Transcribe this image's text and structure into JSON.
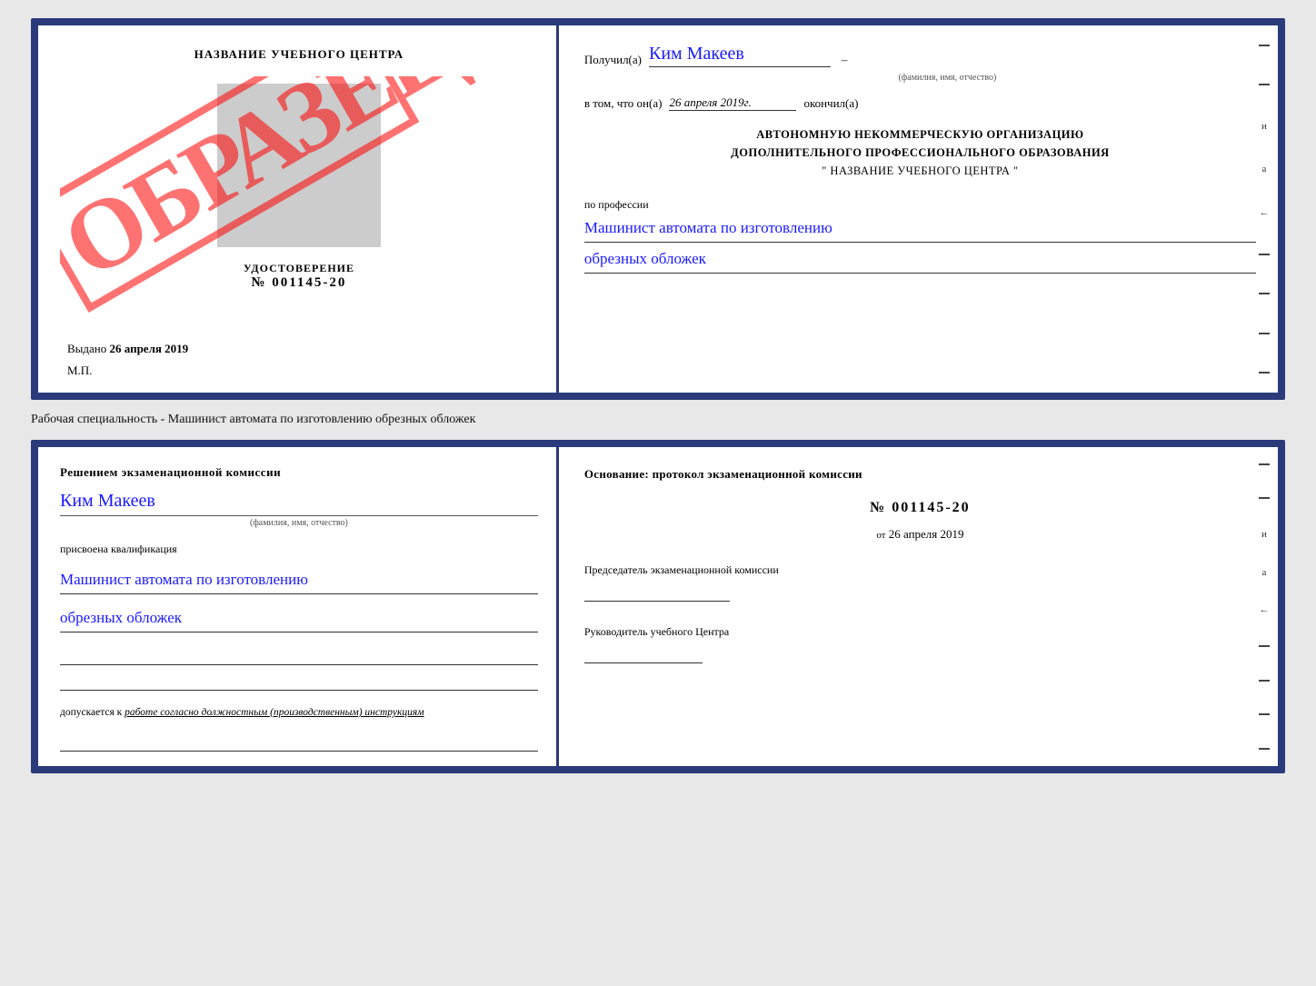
{
  "page": {
    "background": "#e8e8e8"
  },
  "certificate": {
    "left": {
      "title": "НАЗВАНИЕ УЧЕБНОГО ЦЕНТРА",
      "obrazets_text": "ОБРАЗЕЦ",
      "udostoverenie_label": "УДОСТОВЕРЕНИЕ",
      "number_prefix": "№",
      "number": "001145-20",
      "issued_label": "Выдано",
      "issued_date": "26 апреля 2019",
      "mp_label": "М.П."
    },
    "right": {
      "recipient_label": "Получил(а)",
      "recipient_name": "Ким Макеев",
      "recipient_sublabel": "(фамилия, имя, отчество)",
      "dash": "–",
      "date_label": "в том, что он(а)",
      "date_value": "26 апреля 2019г.",
      "finished_label": "окончил(а)",
      "org_line1": "АВТОНОМНУЮ НЕКОММЕРЧЕСКУЮ ОРГАНИЗАЦИЮ",
      "org_line2": "ДОПОЛНИТЕЛЬНОГО ПРОФЕССИОНАЛЬНОГО ОБРАЗОВАНИЯ",
      "org_name": "\"   НАЗВАНИЕ УЧЕБНОГО ЦЕНТРА   \"",
      "profession_label": "по профессии",
      "profession_written_1": "Машинист автомата по изготовлению",
      "profession_written_2": "обрезных обложек"
    }
  },
  "middle": {
    "text": "Рабочая специальность - Машинист автомата по изготовлению обрезных обложек"
  },
  "exam_sheet": {
    "left": {
      "commission_label": "Решением экзаменационной комиссии",
      "name_written": "Ким Макеев",
      "name_sublabel": "(фамилия, имя, отчество)",
      "qualification_label": "присвоена квалификация",
      "qualification_written_1": "Машинист автомата по изготовлению",
      "qualification_written_2": "обрезных обложек",
      "admitted_label": "допускается к",
      "admitted_italic": "работе согласно должностным (производственным) инструкциям"
    },
    "right": {
      "osnov_label": "Основание: протокол экзаменационной комиссии",
      "number_prefix": "№",
      "number": "001145-20",
      "date_ot": "от",
      "date_value": "26 апреля 2019",
      "chairman_label": "Председатель экзаменационной комиссии",
      "director_label": "Руководитель учебного Центра"
    },
    "side_chars": [
      "–",
      "–",
      "и",
      "а",
      "←",
      "–",
      "–",
      "–",
      "–"
    ]
  }
}
